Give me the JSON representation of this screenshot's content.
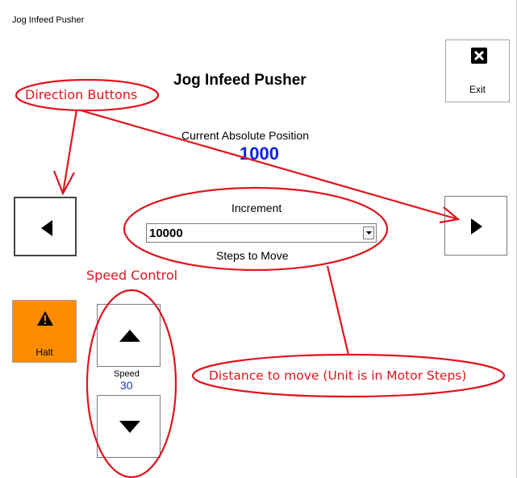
{
  "window": {
    "title": "Jog Infeed Pusher"
  },
  "header": {
    "title": "Jog Infeed Pusher"
  },
  "exit_button": {
    "label": "Exit",
    "icon": "close-box-icon"
  },
  "position": {
    "label": "Current Absolute Position",
    "value": "1000"
  },
  "direction": {
    "left_icon": "arrow-left-icon",
    "right_icon": "arrow-right-icon"
  },
  "increment": {
    "label": "Increment",
    "selected": "10000",
    "sublabel": "Steps to Move"
  },
  "halt_button": {
    "label": "Halt",
    "icon": "warning-icon"
  },
  "speed": {
    "label": "Speed",
    "value": "30",
    "up_icon": "arrow-up-icon",
    "down_icon": "arrow-down-icon"
  },
  "annotations": {
    "direction_buttons": "Direction Buttons",
    "speed_control": "Speed Control",
    "distance": "Distance to move (Unit is in Motor Steps)"
  },
  "colors": {
    "annotation_red": "#e0141e",
    "halt_orange": "#ff8c00",
    "position_blue": "#0b22ee",
    "speed_blue": "#1a35d6"
  }
}
